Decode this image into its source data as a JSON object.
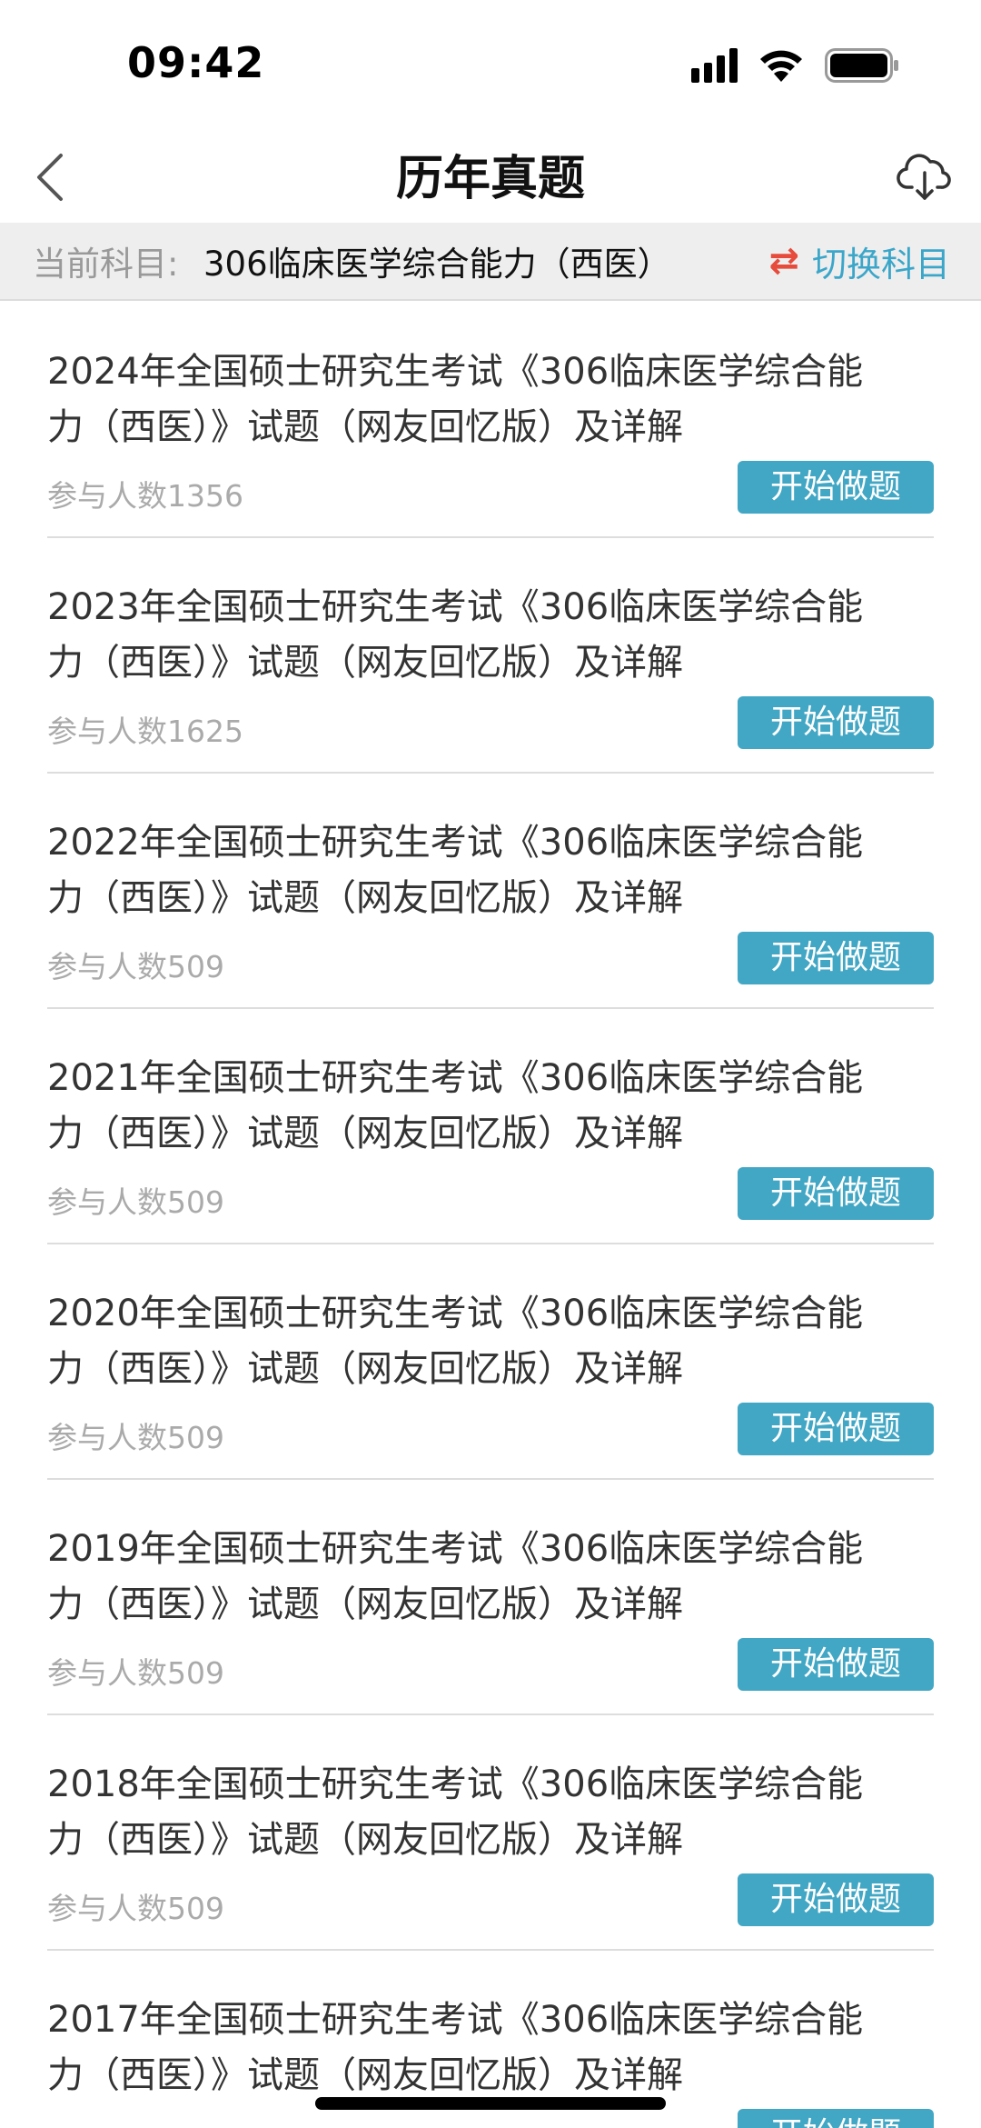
{
  "status_bar": {
    "time": "09:42"
  },
  "nav": {
    "title": "历年真题"
  },
  "subject_bar": {
    "label": "当前科目:",
    "value": "306临床医学综合能力（西医）",
    "switch_icon": "⇄",
    "switch_label": "切换科目"
  },
  "exams": [
    {
      "title": "2024年全国硕士研究生考试《306临床医学综合能力（西医）》试题（网友回忆版）及详解",
      "count": "参与人数1356",
      "button": "开始做题"
    },
    {
      "title": "2023年全国硕士研究生考试《306临床医学综合能力（西医）》试题（网友回忆版）及详解",
      "count": "参与人数1625",
      "button": "开始做题"
    },
    {
      "title": "2022年全国硕士研究生考试《306临床医学综合能力（西医）》试题（网友回忆版）及详解",
      "count": "参与人数509",
      "button": "开始做题"
    },
    {
      "title": "2021年全国硕士研究生考试《306临床医学综合能力（西医）》试题（网友回忆版）及详解",
      "count": "参与人数509",
      "button": "开始做题"
    },
    {
      "title": "2020年全国硕士研究生考试《306临床医学综合能力（西医）》试题（网友回忆版）及详解",
      "count": "参与人数509",
      "button": "开始做题"
    },
    {
      "title": "2019年全国硕士研究生考试《306临床医学综合能力（西医）》试题（网友回忆版）及详解",
      "count": "参与人数509",
      "button": "开始做题"
    },
    {
      "title": "2018年全国硕士研究生考试《306临床医学综合能力（西医）》试题（网友回忆版）及详解",
      "count": "参与人数509",
      "button": "开始做题"
    },
    {
      "title": "2017年全国硕士研究生考试《306临床医学综合能力（西医）》试题（网友回忆版）及详解",
      "count": "",
      "button": "开始做题"
    }
  ],
  "colors": {
    "accent": "#42a7c4",
    "switch_icon": "#e64b3c"
  },
  "icons": [
    "signal-icon",
    "wifi-icon",
    "battery-icon",
    "back-icon",
    "cloud-download-icon",
    "swap-icon"
  ]
}
